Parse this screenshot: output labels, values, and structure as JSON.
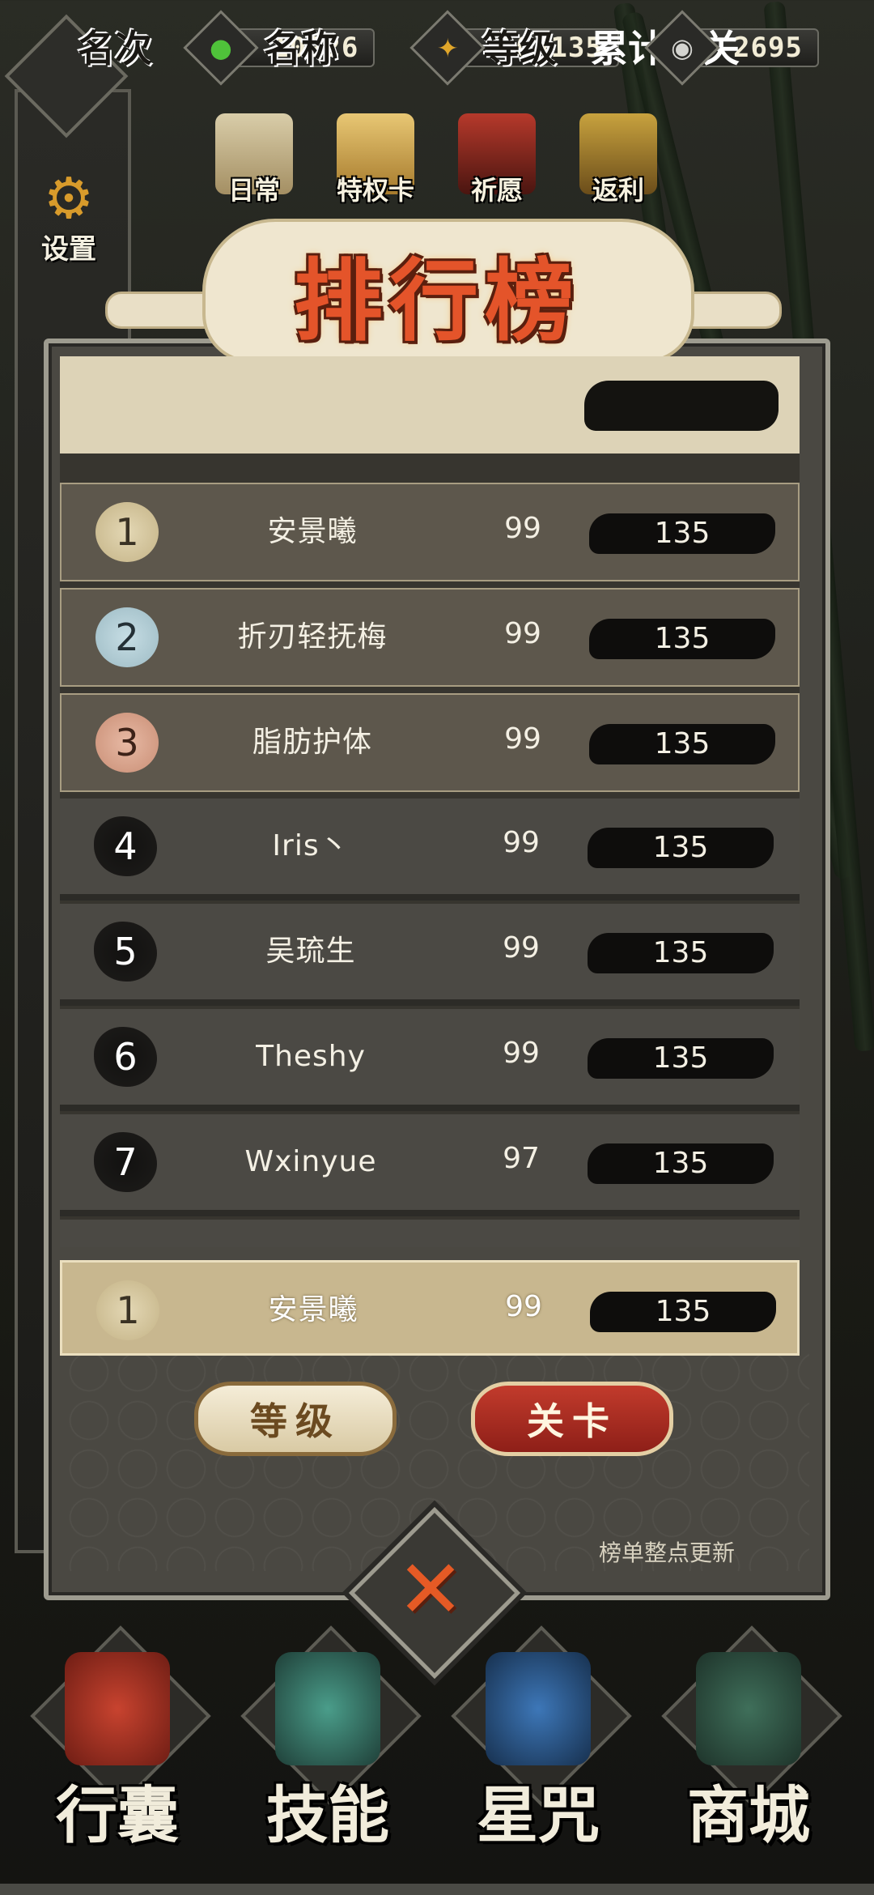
{
  "currencies": [
    {
      "icon": "green-jade-icon",
      "value": "10926",
      "color": "#4fc23a"
    },
    {
      "icon": "gold-coin-icon",
      "value": "304135",
      "color": "#e0a62a"
    },
    {
      "icon": "silver-coin-icon",
      "value": "2695",
      "color": "#d4d4d0"
    }
  ],
  "side": {
    "settings_label": "设置"
  },
  "top_icons": [
    {
      "label": "日常",
      "icon": "scroll-icon"
    },
    {
      "label": "特权卡",
      "icon": "privilege-card-icon"
    },
    {
      "label": "祈愿",
      "icon": "shrine-gate-icon"
    },
    {
      "label": "返利",
      "icon": "treasure-chest-icon"
    }
  ],
  "panel": {
    "title": "排行榜",
    "headers": {
      "rank": "名次",
      "name": "名称",
      "level": "等级",
      "stages": "累计通关"
    },
    "rows": [
      {
        "rank": "1",
        "name": "安景曦",
        "level": "99",
        "stages": "135"
      },
      {
        "rank": "2",
        "name": "折刃轻抚梅",
        "level": "99",
        "stages": "135"
      },
      {
        "rank": "3",
        "name": "脂肪护体",
        "level": "99",
        "stages": "135"
      },
      {
        "rank": "4",
        "name": "Iris丶",
        "level": "99",
        "stages": "135"
      },
      {
        "rank": "5",
        "name": "吴琉生",
        "level": "99",
        "stages": "135"
      },
      {
        "rank": "6",
        "name": "Theshy",
        "level": "99",
        "stages": "135"
      },
      {
        "rank": "7",
        "name": "Wxinyue",
        "level": "97",
        "stages": "135"
      }
    ],
    "self_row": {
      "rank": "1",
      "name": "安景曦",
      "level": "99",
      "stages": "135"
    },
    "buttons": {
      "level": "等级",
      "stage": "关卡"
    },
    "update_note": "榜单整点更新",
    "close_icon": "close-x-icon"
  },
  "bottom_nav": [
    {
      "label": "行囊",
      "icon": "bag-icon"
    },
    {
      "label": "技能",
      "icon": "blade-icon"
    },
    {
      "label": "星咒",
      "icon": "star-scroll-icon"
    },
    {
      "label": "商城",
      "icon": "shop-icon"
    }
  ]
}
